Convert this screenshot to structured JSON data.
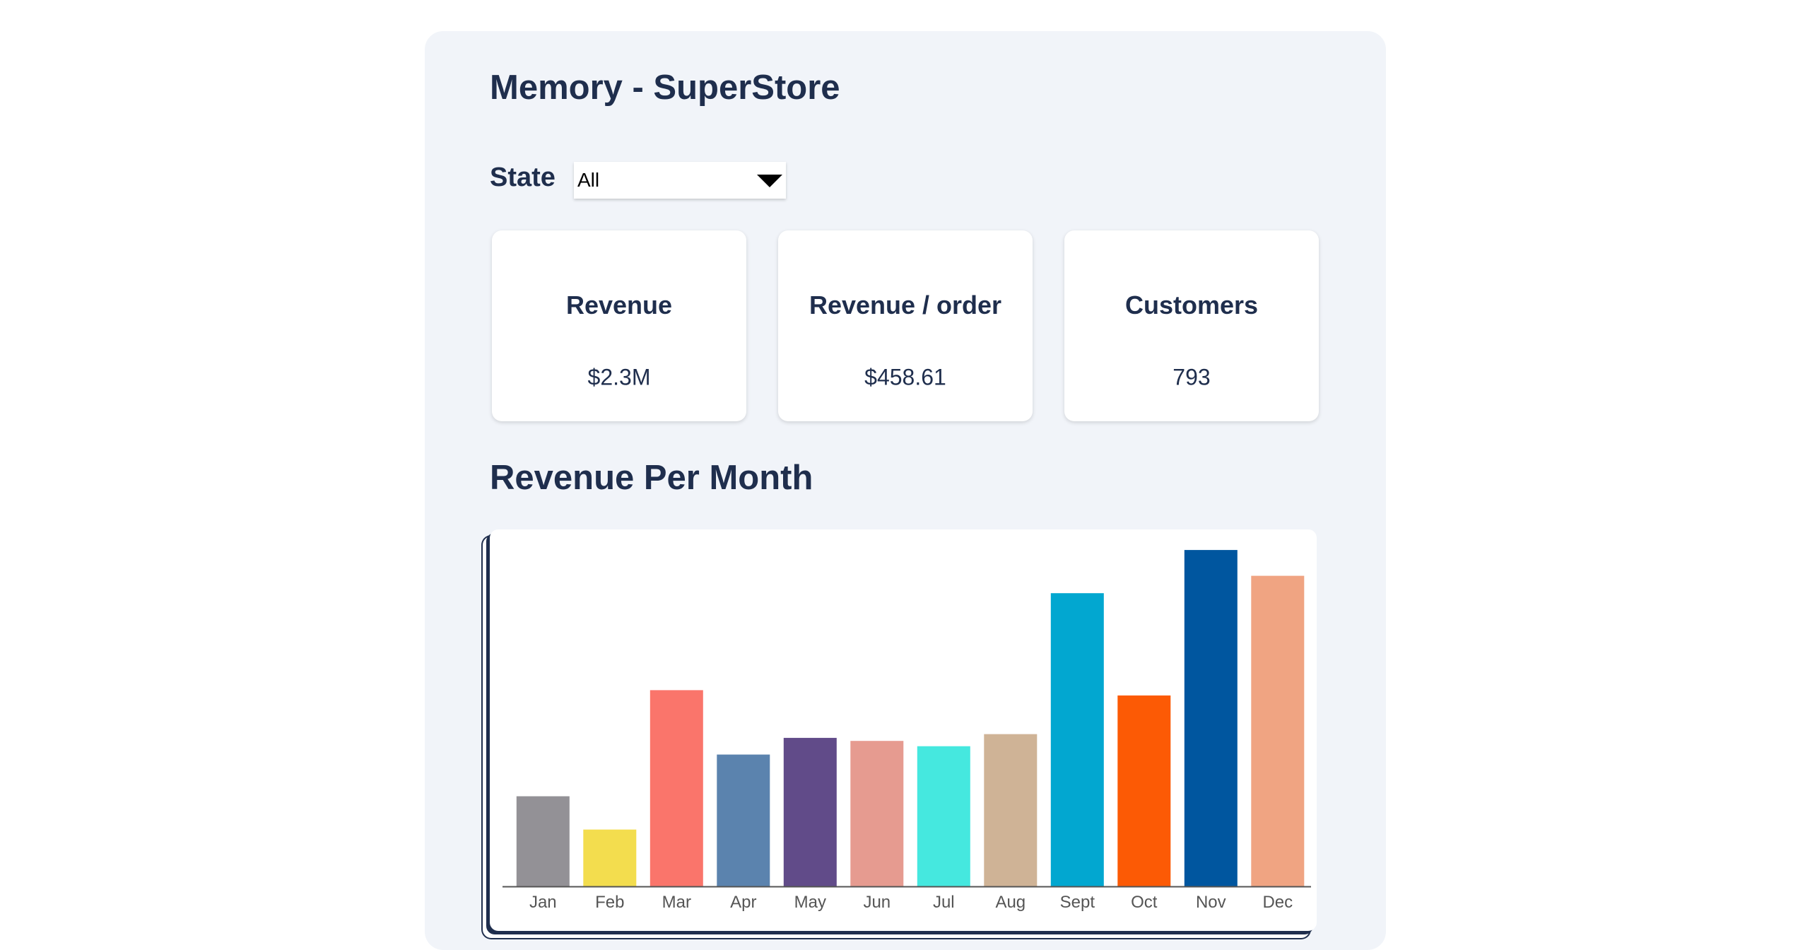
{
  "app": {
    "title": "Memory - SuperStore"
  },
  "filter": {
    "label": "State",
    "selected": "All"
  },
  "kpis": [
    {
      "label": "Revenue",
      "value": "$2.3M"
    },
    {
      "label": "Revenue / order",
      "value": "$458.61"
    },
    {
      "label": "Customers",
      "value": "793"
    }
  ],
  "section": {
    "title": "Revenue Per Month"
  },
  "colors": {
    "text": "#1f2e4d",
    "panel": "#f1f4f9",
    "axis": "#555555"
  },
  "chart_data": {
    "type": "bar",
    "categories": [
      "Jan",
      "Feb",
      "Mar",
      "Apr",
      "May",
      "Jun",
      "Jul",
      "Aug",
      "Sept",
      "Oct",
      "Nov",
      "Dec"
    ],
    "values": [
      119,
      75,
      259,
      174,
      196,
      192,
      185,
      201,
      387,
      252,
      444,
      410
    ],
    "colors": [
      "#939196",
      "#f3dd4e",
      "#fa756b",
      "#5b83ae",
      "#614b89",
      "#e69b90",
      "#45e8df",
      "#cfb396",
      "#02a7d0",
      "#fc5a05",
      "#00569f",
      "#f0a482"
    ],
    "ylim": [
      0,
      460
    ],
    "grid": false,
    "xlabel": "",
    "ylabel": ""
  }
}
